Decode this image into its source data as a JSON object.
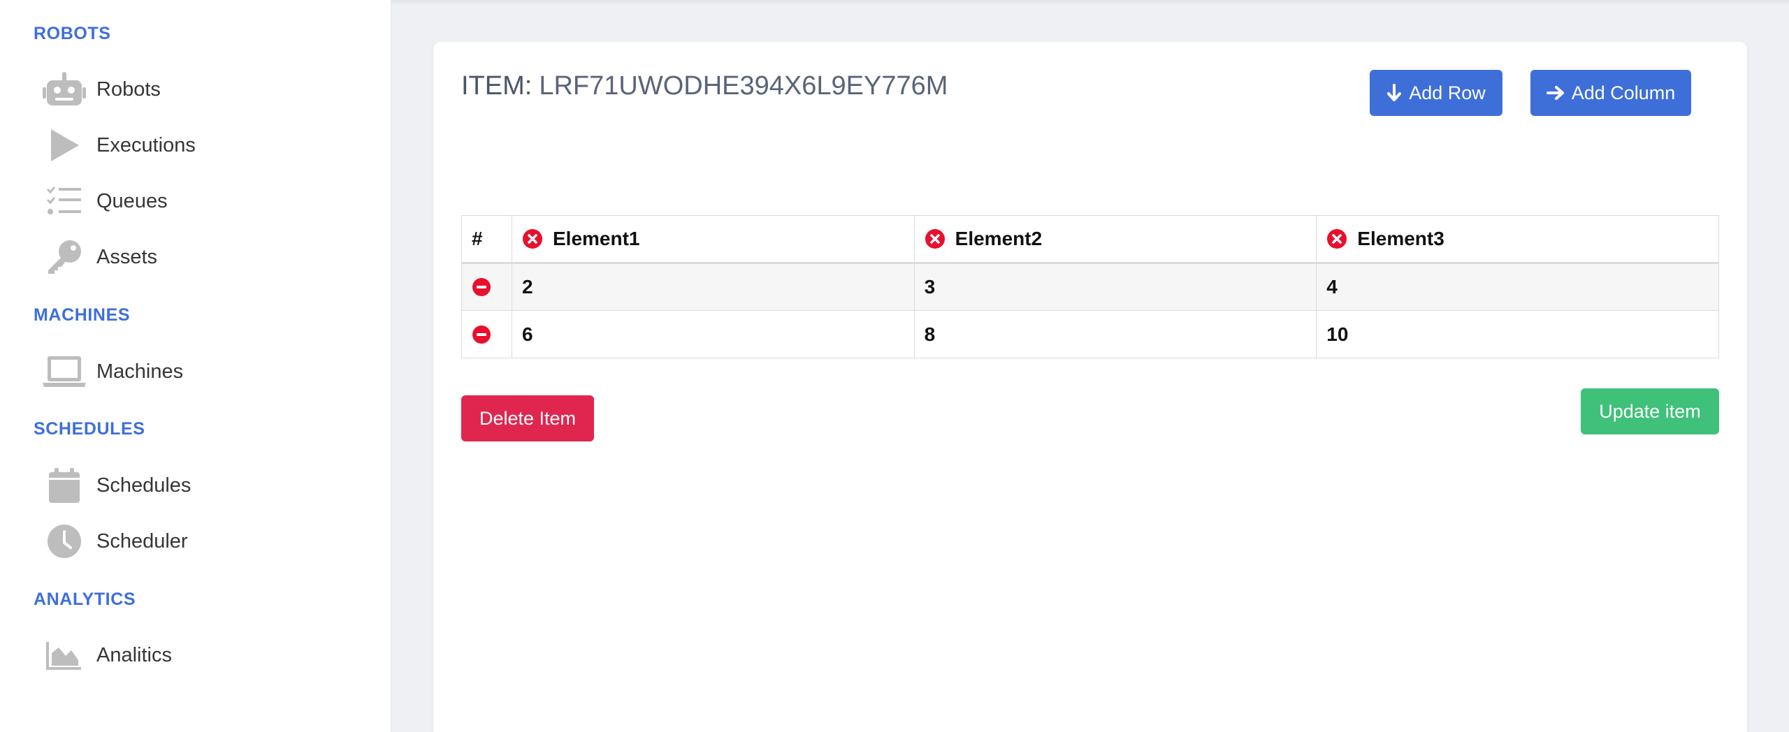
{
  "sidebar": {
    "sections": [
      {
        "title": "ROBOTS",
        "items": [
          {
            "label": "Robots",
            "icon": "robot-icon"
          },
          {
            "label": "Executions",
            "icon": "play-icon"
          },
          {
            "label": "Queues",
            "icon": "tasks-icon"
          },
          {
            "label": "Assets",
            "icon": "key-icon"
          }
        ]
      },
      {
        "title": "MACHINES",
        "items": [
          {
            "label": "Machines",
            "icon": "laptop-icon"
          }
        ]
      },
      {
        "title": "SCHEDULES",
        "items": [
          {
            "label": "Schedules",
            "icon": "calendar-icon"
          },
          {
            "label": "Scheduler",
            "icon": "clock-icon"
          }
        ]
      },
      {
        "title": "ANALYTICS",
        "items": [
          {
            "label": "Analitics",
            "icon": "area-chart-icon"
          }
        ]
      }
    ]
  },
  "item": {
    "prefix": "ITEM:",
    "id": "LRF71UWODHE394X6L9EY776M"
  },
  "buttons": {
    "add_row": "Add Row",
    "add_column": "Add Column",
    "delete_item": "Delete Item",
    "update_item": "Update item"
  },
  "table": {
    "hash": "#",
    "columns": [
      "Element1",
      "Element2",
      "Element3"
    ],
    "rows": [
      [
        "2",
        "3",
        "4"
      ],
      [
        "6",
        "8",
        "10"
      ]
    ]
  },
  "colors": {
    "accent": "#3e6fd9",
    "danger": "#e0264f",
    "success": "#3fc17a",
    "remove_icon": "#e8102d",
    "icon_gray": "#bdbdbd"
  }
}
